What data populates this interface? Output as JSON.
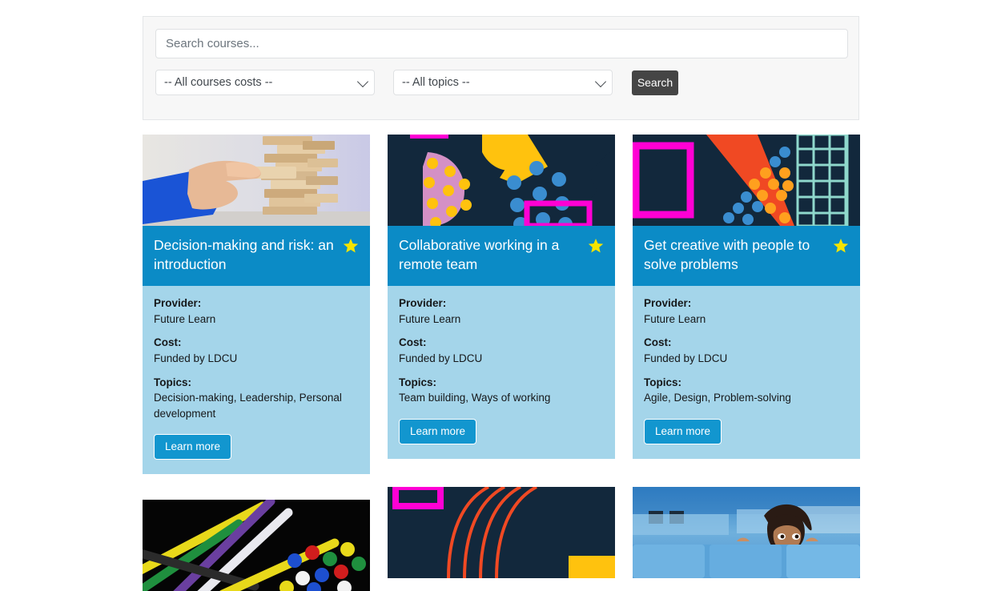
{
  "search": {
    "placeholder": "Search courses...",
    "value": "",
    "cost_filter_selected": "-- All courses costs --",
    "topic_filter_selected": "-- All topics --",
    "search_button_label": "Search",
    "caret_icon": "chevron-down-icon"
  },
  "labels": {
    "provider": "Provider:",
    "cost": "Cost:",
    "topics": "Topics:",
    "learn_more": "Learn more",
    "star_icon": "star-icon"
  },
  "colors": {
    "header_blue": "#0b8bc6",
    "body_blue": "#a4d5ea",
    "star_yellow": "#f5e400",
    "button_blue": "#1296cf",
    "search_button_gray": "#454545",
    "panel_gray": "#f7f7f7",
    "artwork_navy": "#12283c",
    "artwork_magenta": "#ff00d4",
    "artwork_yellow": "#ffc20e",
    "artwork_orange": "#f04923",
    "artwork_blue_dot": "#3a8dd0",
    "artwork_pink": "#d490c5",
    "artwork_mint": "#8fd8cc"
  },
  "cards": [
    {
      "title": "Decision-making and risk: an introduction",
      "provider": "Future Learn",
      "cost": "Funded by LDCU",
      "topics": "Decision-making, Leadership, Personal development",
      "image": "photo-hand-wooden-block-tower",
      "starred": true
    },
    {
      "title": "Collaborative working in a remote team",
      "provider": "Future Learn",
      "cost": "Funded by LDCU",
      "topics": "Team building, Ways of working",
      "image": "abstract-geometric-dots-shapes",
      "starred": true
    },
    {
      "title": "Get creative with people to solve problems",
      "provider": "Future Learn",
      "cost": "Funded by LDCU",
      "topics": "Agile, Design, Problem-solving",
      "image": "abstract-geometric-grid-diagonal",
      "starred": true
    }
  ],
  "cards_row2": [
    {
      "image": "photo-colourful-braided-ropes"
    },
    {
      "image": "abstract-navy-red-curves"
    },
    {
      "image": "photo-woman-peeking-over-office-cubicle"
    }
  ]
}
